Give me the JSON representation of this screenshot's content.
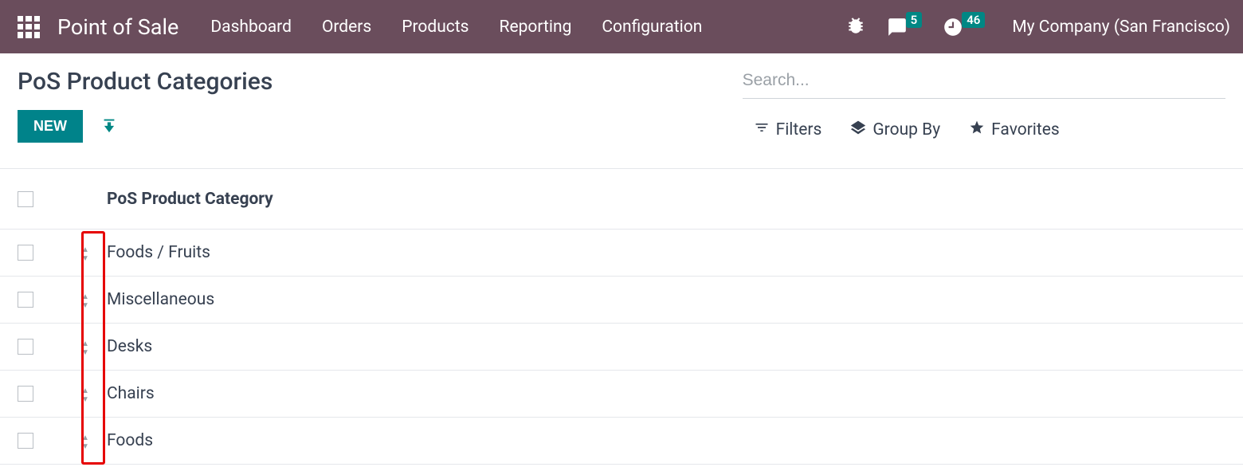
{
  "navbar": {
    "brand": "Point of Sale",
    "links": [
      "Dashboard",
      "Orders",
      "Products",
      "Reporting",
      "Configuration"
    ],
    "messages_badge": "5",
    "activities_badge": "46",
    "company": "My Company (San Francisco)"
  },
  "breadcrumb": "PoS Product Categories",
  "buttons": {
    "new_label": "NEW"
  },
  "search": {
    "placeholder": "Search..."
  },
  "tools": {
    "filters": "Filters",
    "groupby": "Group By",
    "favorites": "Favorites"
  },
  "table": {
    "header": "PoS Product Category",
    "rows": [
      {
        "name": "Foods / Fruits"
      },
      {
        "name": "Miscellaneous"
      },
      {
        "name": "Desks"
      },
      {
        "name": "Chairs"
      },
      {
        "name": "Foods"
      }
    ]
  }
}
